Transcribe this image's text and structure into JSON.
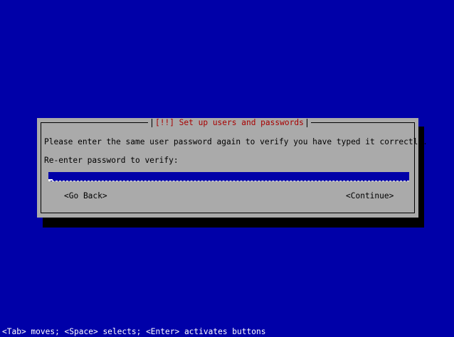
{
  "dialog": {
    "title": "[!!] Set up users and passwords",
    "prompt": "Please enter the same user password again to verify you have typed it correctly.",
    "field_label": "Re-enter password to verify:",
    "password_value": "",
    "back_label": "<Go Back>",
    "continue_label": "<Continue>"
  },
  "status_bar": "<Tab> moves; <Space> selects; <Enter> activates buttons",
  "colors": {
    "background": "#0000a8",
    "dialog": "#aaaaaa",
    "title_text": "#a80000",
    "field": "#0000a8",
    "status_text": "#ffffff"
  }
}
